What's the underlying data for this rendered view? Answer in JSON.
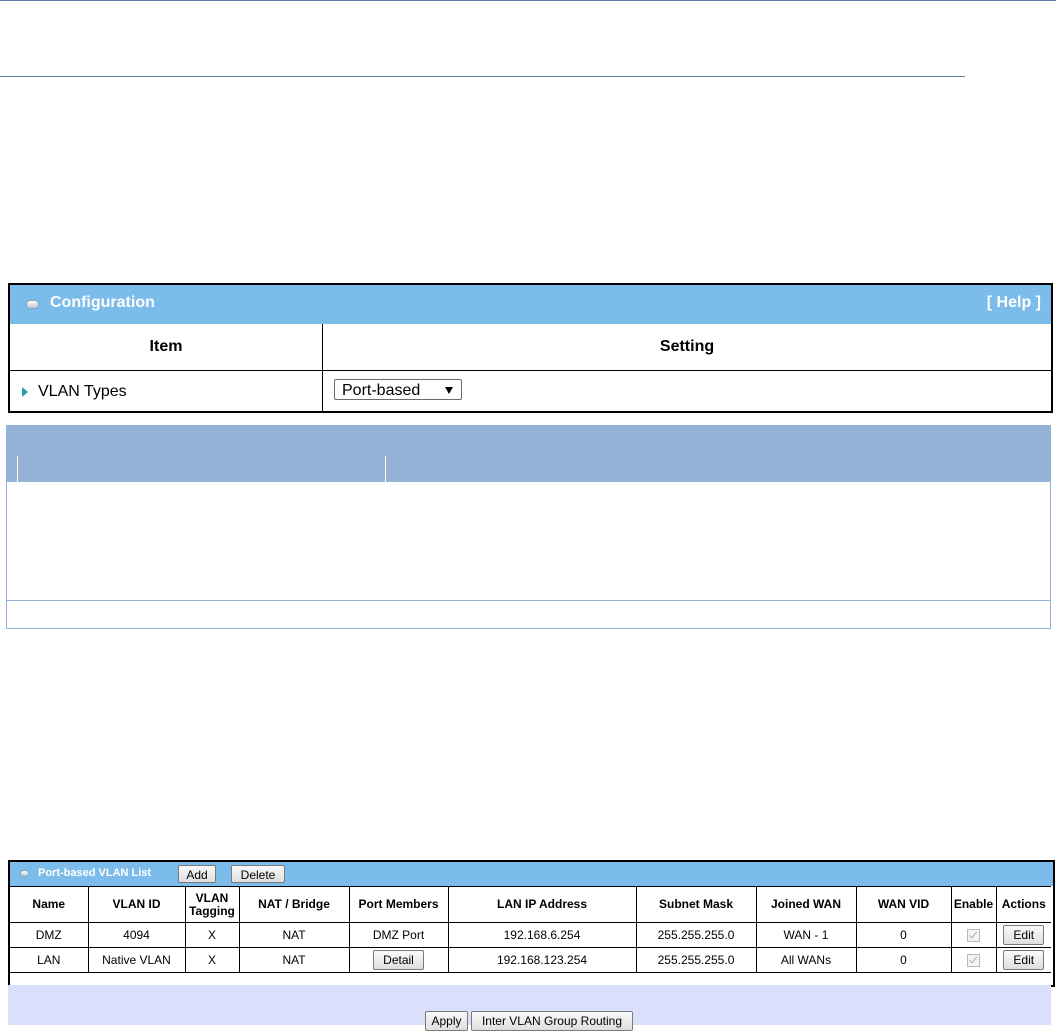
{
  "config": {
    "title": "Configuration",
    "help": "[ Help ]",
    "col_item": "Item",
    "col_setting": "Setting",
    "row_label": "VLAN Types",
    "vlan_type": "Port-based"
  },
  "vlan_list": {
    "title": "Port-based VLAN List",
    "add_label": "Add",
    "delete_label": "Delete",
    "headers": [
      "Name",
      "VLAN ID",
      "VLAN Tagging",
      "NAT / Bridge",
      "Port Members",
      "LAN IP Address",
      "Subnet Mask",
      "Joined WAN",
      "WAN VID",
      "Enable",
      "Actions"
    ],
    "rows": [
      {
        "name": "DMZ",
        "vlan_id": "4094",
        "tagging": "X",
        "nat_bridge": "NAT",
        "port_members": "DMZ Port",
        "lan_ip": "192.168.6.254",
        "subnet": "255.255.255.0",
        "joined_wan": "WAN - 1",
        "wan_vid": "0",
        "enabled": true,
        "action": "Edit"
      },
      {
        "name": "LAN",
        "vlan_id": "Native VLAN",
        "tagging": "X",
        "nat_bridge": "NAT",
        "port_members": "Detail",
        "lan_ip": "192.168.123.254",
        "subnet": "255.255.255.0",
        "joined_wan": "All WANs",
        "wan_vid": "0",
        "enabled": true,
        "action": "Edit"
      }
    ],
    "apply_label": "Apply",
    "routing_label": "Inter VLAN Group Routing"
  }
}
